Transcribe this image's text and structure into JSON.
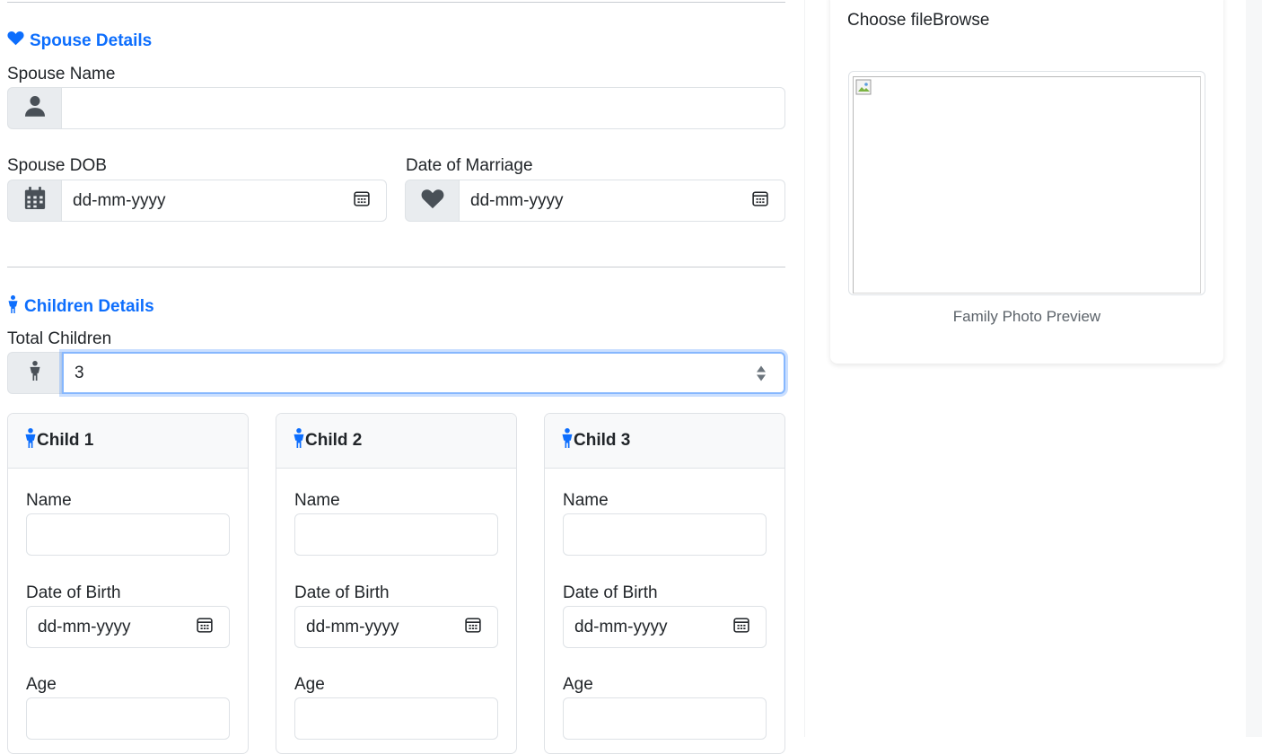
{
  "spouse": {
    "section_title": "Spouse Details",
    "name_label": "Spouse Name",
    "name_value": "",
    "dob_label": "Spouse DOB",
    "dob_value": "dd-mm-yyyy",
    "marriage_label": "Date of Marriage",
    "marriage_value": "dd-mm-yyyy"
  },
  "children": {
    "section_title": "Children Details",
    "total_label": "Total Children",
    "total_value": "3",
    "cards": [
      {
        "title": "Child 1",
        "name_label": "Name",
        "dob_label": "Date of Birth",
        "dob_value": "dd-mm-yyyy",
        "age_label": "Age"
      },
      {
        "title": "Child 2",
        "name_label": "Name",
        "dob_label": "Date of Birth",
        "dob_value": "dd-mm-yyyy",
        "age_label": "Age"
      },
      {
        "title": "Child 3",
        "name_label": "Name",
        "dob_label": "Date of Birth",
        "dob_value": "dd-mm-yyyy",
        "age_label": "Age"
      }
    ]
  },
  "photo": {
    "file_input_text": "Choose fileBrowse",
    "preview_caption": "Family Photo Preview"
  },
  "icons": {
    "spouse_section": "heart-icon",
    "children_section": "child-icon",
    "name_addon": "person-icon",
    "dob_addon": "calendar-icon",
    "marriage_addon": "heart-icon",
    "total_addon": "child-icon",
    "date_picker": "calendar-icon",
    "child_card": "child-icon"
  },
  "colors": {
    "accent": "#0d6efd",
    "addon_bg": "#e9ecef",
    "border": "#dee2e6",
    "focus_ring": "#86b7fe"
  }
}
